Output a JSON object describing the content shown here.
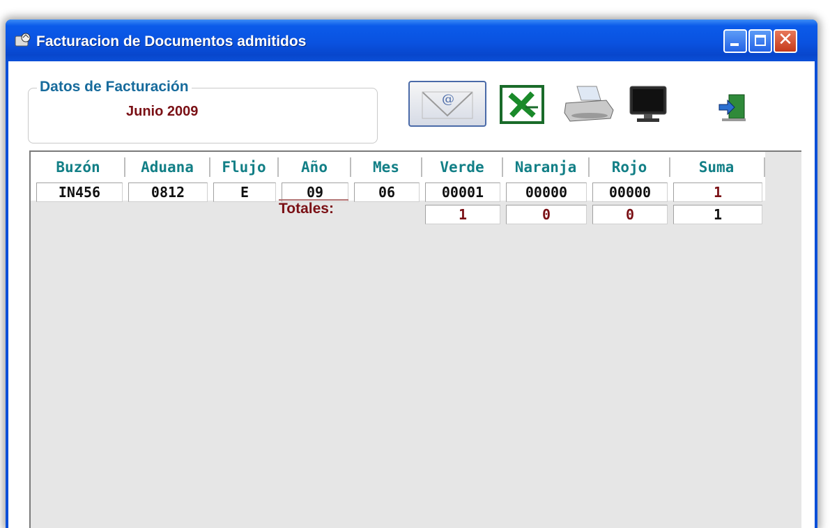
{
  "window": {
    "title": "Facturacion de Documentos admitidos"
  },
  "billing": {
    "group_title": "Datos de Facturación",
    "period": "Junio 2009"
  },
  "toolbar": [
    "mail-icon",
    "excel-icon",
    "printer-icon",
    "monitor-icon",
    "exit-icon"
  ],
  "table": {
    "headers": [
      "Buzón",
      "Aduana",
      "Flujo",
      "Año",
      "Mes",
      "Verde",
      "Naranja",
      "Rojo",
      "Suma"
    ],
    "rows": [
      [
        "IN456",
        "0812",
        "E",
        "09",
        "06",
        "00001",
        "00000",
        "00000",
        "1"
      ]
    ],
    "totals_label": "Totales:",
    "totals": {
      "verde": "1",
      "naranja": "0",
      "rojo": "0",
      "suma": "1"
    }
  },
  "colors": {
    "titlebar": "#0a52e0",
    "header_text": "#127f86",
    "accent_red": "#7a1015",
    "grid_bg": "#e6e6e6"
  }
}
